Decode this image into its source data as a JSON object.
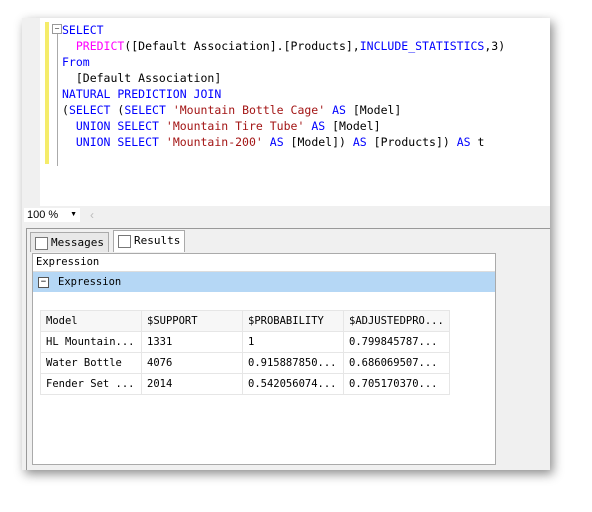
{
  "editor": {
    "lines": [
      [
        [
          "k",
          "SELECT"
        ]
      ],
      [
        [
          "t",
          "  "
        ],
        [
          "f",
          "PREDICT"
        ],
        [
          "t",
          "([Default Association].[Products],"
        ],
        [
          "k",
          "INCLUDE_STATISTICS"
        ],
        [
          "t",
          ",3)"
        ]
      ],
      [
        [
          "k",
          "From"
        ]
      ],
      [
        [
          "t",
          "  [Default Association]"
        ]
      ],
      [
        [
          "k",
          "NATURAL PREDICTION JOIN"
        ]
      ],
      [
        [
          "t",
          "("
        ],
        [
          "k",
          "SELECT"
        ],
        [
          "t",
          " ("
        ],
        [
          "k",
          "SELECT"
        ],
        [
          "t",
          " "
        ],
        [
          "s",
          "'Mountain Bottle Cage'"
        ],
        [
          "t",
          " "
        ],
        [
          "k",
          "AS"
        ],
        [
          "t",
          " [Model]"
        ]
      ],
      [
        [
          "t",
          "  "
        ],
        [
          "k",
          "UNION SELECT"
        ],
        [
          "t",
          " "
        ],
        [
          "s",
          "'Mountain Tire Tube'"
        ],
        [
          "t",
          " "
        ],
        [
          "k",
          "AS"
        ],
        [
          "t",
          " [Model]"
        ]
      ],
      [
        [
          "t",
          "  "
        ],
        [
          "k",
          "UNION SELECT"
        ],
        [
          "t",
          " "
        ],
        [
          "s",
          "'Mountain-200'"
        ],
        [
          "t",
          " "
        ],
        [
          "k",
          "AS"
        ],
        [
          "t",
          " [Model]) "
        ],
        [
          "k",
          "AS"
        ],
        [
          "t",
          " [Products]) "
        ],
        [
          "k",
          "AS"
        ],
        [
          "t",
          " t"
        ]
      ]
    ]
  },
  "zoom": {
    "value": "100 %"
  },
  "tabs": {
    "messages": "Messages",
    "results": "Results"
  },
  "grid": {
    "header": "Expression",
    "group": "Expression",
    "columns": [
      "Model",
      "$SUPPORT",
      "$PROBABILITY",
      "$ADJUSTEDPRO..."
    ],
    "rows": [
      [
        "HL Mountain...",
        "1331",
        "1",
        "0.799845787..."
      ],
      [
        "Water Bottle",
        "4076",
        "0.915887850...",
        "0.686069507..."
      ],
      [
        "Fender Set ...",
        "2014",
        "0.542056074...",
        "0.705170370..."
      ]
    ]
  }
}
